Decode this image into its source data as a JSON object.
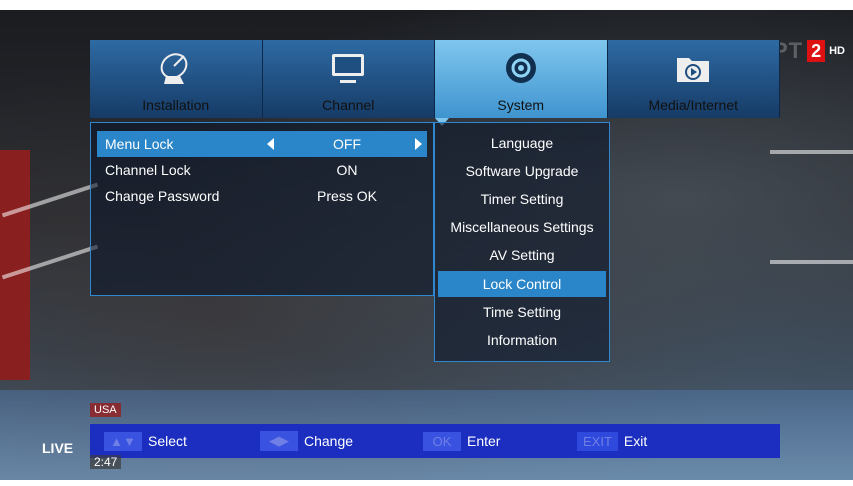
{
  "channel": {
    "watermark": "EPT",
    "number": "2",
    "quality": "HD"
  },
  "menu_tabs": [
    {
      "label": "Installation",
      "icon": "satellite-dish-icon",
      "active": false
    },
    {
      "label": "Channel",
      "icon": "tv-icon",
      "active": false
    },
    {
      "label": "System",
      "icon": "gear-icon",
      "active": true
    },
    {
      "label": "Media/Internet",
      "icon": "media-folder-icon",
      "active": false
    }
  ],
  "lock_settings": [
    {
      "label": "Menu Lock",
      "value": "OFF",
      "selected": true
    },
    {
      "label": "Channel Lock",
      "value": "ON",
      "selected": false
    },
    {
      "label": "Change Password",
      "value": "Press OK",
      "selected": false
    }
  ],
  "system_menu": [
    "Language",
    "Software Upgrade",
    "Timer Setting",
    "Miscellaneous Settings",
    "AV Setting",
    "Lock Control",
    "Time Setting",
    "Information"
  ],
  "system_menu_selected": "Lock Control",
  "help": {
    "select_key": "▲▼",
    "select_label": "Select",
    "change_key": "◀▶",
    "change_label": "Change",
    "ok_key": "OK",
    "ok_label": "Enter",
    "exit_key": "EXIT",
    "exit_label": "Exit"
  },
  "overlay": {
    "live": "LIVE",
    "country": "USA",
    "clock": "2:47"
  },
  "colors": {
    "highlight": "#2a86c8",
    "help_bar": "#1c2ec0",
    "tab_active": "#7fc6ee"
  }
}
